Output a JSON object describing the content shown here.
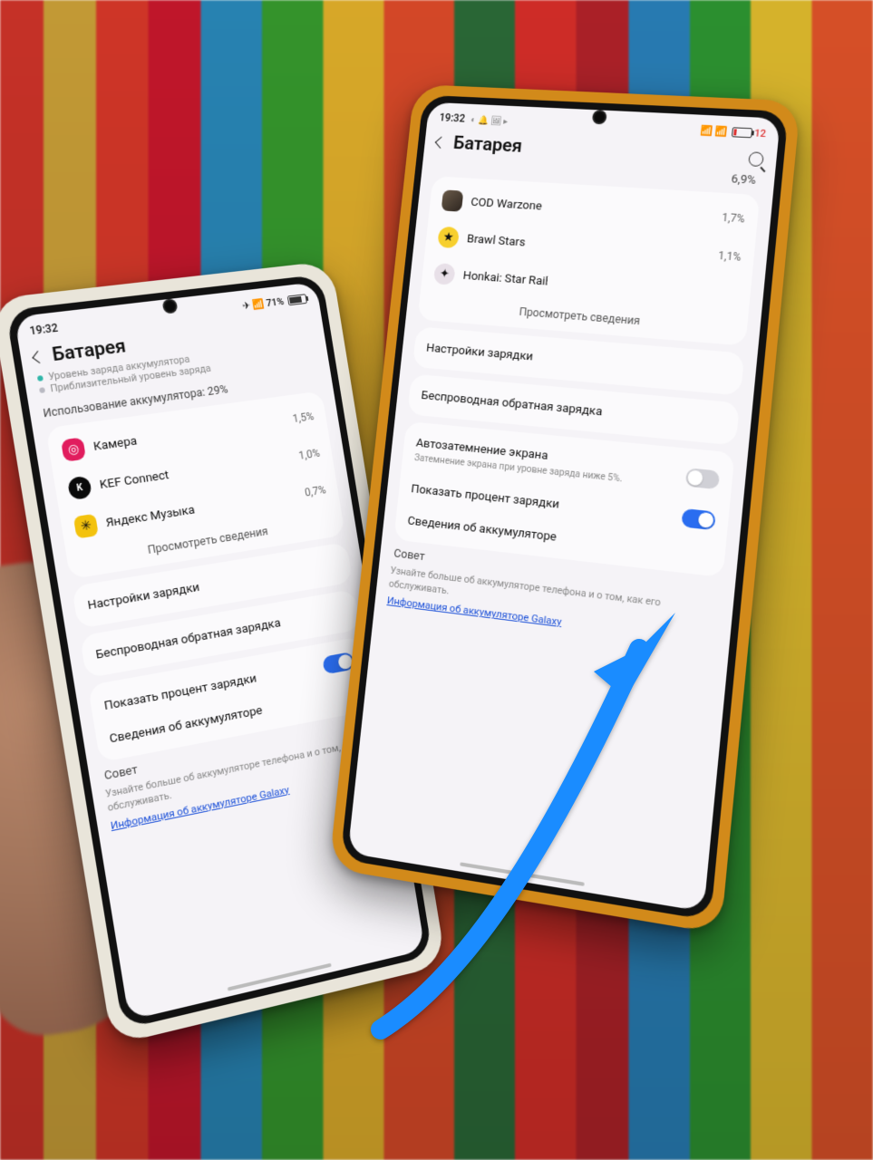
{
  "left": {
    "status": {
      "time": "19:32",
      "icons": "✈ 📶",
      "batt_pct": "71%",
      "batt_fill_pct": 71
    },
    "title": "Батарея",
    "legend": {
      "a": "Уровень заряда аккумулятора",
      "b": "Приблизительный уровень заряда"
    },
    "usage_header": "Использование аккумулятора: 29%",
    "apps": [
      {
        "name": "Камера",
        "pct": "1,5%",
        "ico": "ico-cam",
        "glyph": "◎"
      },
      {
        "name": "KEF Connect",
        "pct": "1,0%",
        "ico": "ico-kef",
        "glyph": "K"
      },
      {
        "name": "Яндекс Музыка",
        "pct": "0,7%",
        "ico": "ico-ym",
        "glyph": "✳"
      }
    ],
    "view_all": "Просмотреть сведения",
    "rows": {
      "charging": "Настройки зарядки",
      "wireless": "Беспроводная обратная зарядка",
      "show_pct": "Показать процент зарядки",
      "info": "Сведения об аккумуляторе"
    },
    "tip": {
      "h": "Совет",
      "b": "Узнайте больше об аккумуляторе телефона и о том, как его обслуживать.",
      "link": "Информация об аккумуляторе Galaxy"
    }
  },
  "right": {
    "status": {
      "time": "19:32",
      "icons_l": "◐ 🔔 🖼 ▸",
      "icons_r": "📶 📶",
      "batt_pct": "12",
      "batt_fill_pct": 12
    },
    "title": "Батарея",
    "big_pct": "6,9%",
    "apps": [
      {
        "name": "COD Warzone",
        "pct": "1,7%",
        "ico": "ico-wz",
        "glyph": ""
      },
      {
        "name": "Brawl Stars",
        "pct": "1,1%",
        "ico": "ico-bs",
        "glyph": "★"
      },
      {
        "name": "Honkai: Star Rail",
        "pct": "",
        "ico": "ico-hk",
        "glyph": "✦"
      }
    ],
    "view_all": "Просмотреть сведения",
    "rows": {
      "charging": "Настройки зарядки",
      "wireless": "Беспроводная обратная зарядка",
      "autodim": "Автозатемнение экрана",
      "autodim_sub": "Затемнение экрана при уровне заряда ниже 5%.",
      "show_pct": "Показать процент зарядки",
      "info": "Сведения об аккумуляторе"
    },
    "tip": {
      "h": "Совет",
      "b": "Узнайте больше об аккумуляторе телефона и о том, как его обслуживать.",
      "link": "Информация об аккумуляторе Galaxy"
    }
  }
}
